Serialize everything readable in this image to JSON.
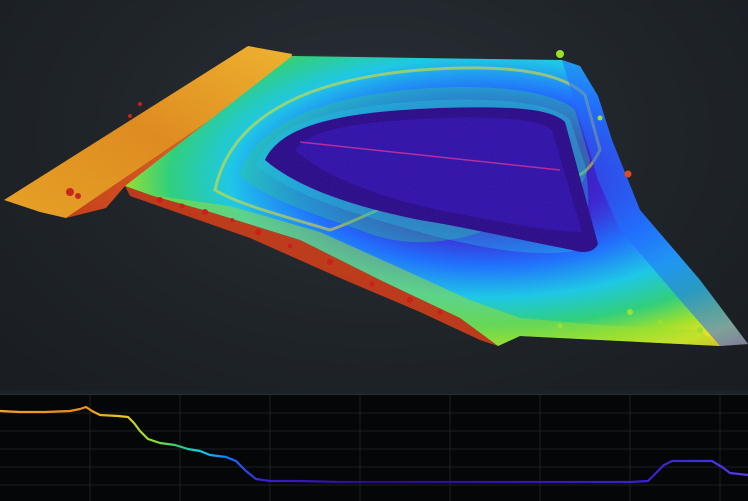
{
  "viewport": {
    "background": "#1f2429",
    "colormap": [
      "#2a0a8a",
      "#3a1fd0",
      "#1b6cff",
      "#18c8e8",
      "#2bd07a",
      "#9ae22a",
      "#f2e21c",
      "#f6a31c",
      "#ee5a1a",
      "#c8201a"
    ]
  },
  "profile": {
    "background": "#050607",
    "grid": true,
    "grid_color": "#1c2024"
  }
}
